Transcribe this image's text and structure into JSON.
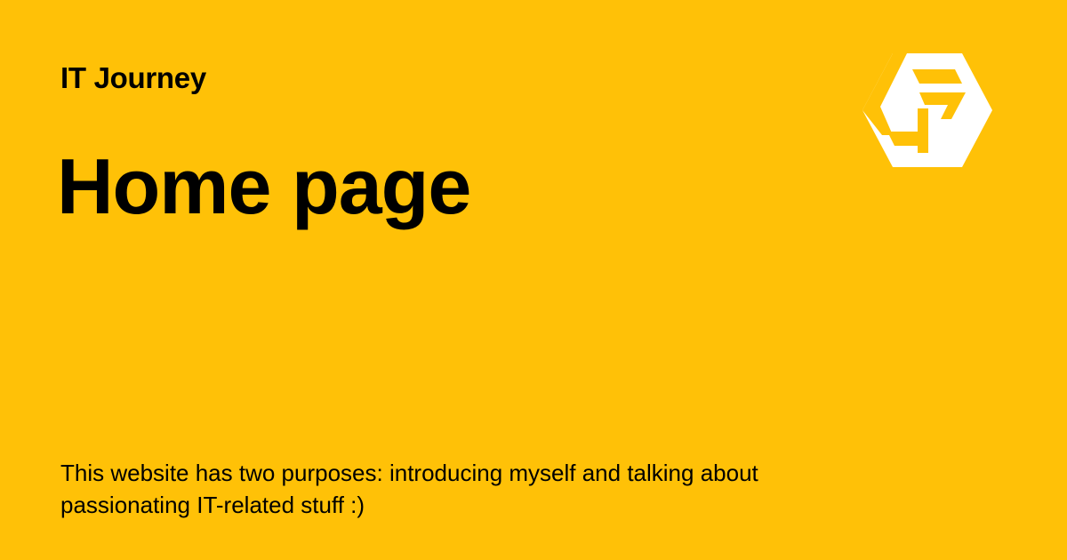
{
  "theme": {
    "background": "#FFC107",
    "text": "#000000",
    "logo_color": "#FFFFFF"
  },
  "site": {
    "name": "IT Journey"
  },
  "page": {
    "title": "Home page",
    "description": "This website has two purposes: introducing myself and talking about passionating IT-related stuff :)"
  },
  "logo": {
    "icon": "hexagon-monogram-logo-icon"
  }
}
